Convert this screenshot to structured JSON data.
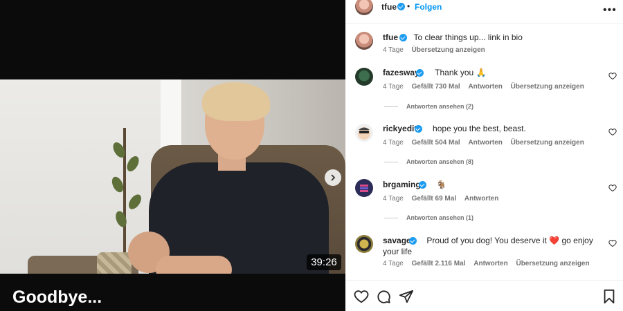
{
  "media": {
    "duration": "39:26",
    "caption_title": "Goodbye..."
  },
  "post": {
    "author": "tfue",
    "dot": "•",
    "follow_label": "Folgen",
    "more_label": "•••",
    "caption": {
      "username": "tfue",
      "text": "To clear things up... link in bio",
      "age": "4 Tage",
      "translate": "Übersetzung anzeigen"
    }
  },
  "comments": [
    {
      "username": "fazesway",
      "text": "Thank you 🙏",
      "age": "4 Tage",
      "likes": "Gefällt 730 Mal",
      "reply": "Antworten",
      "translate": "Übersetzung anzeigen",
      "view_replies": "Antworten ansehen (2)"
    },
    {
      "username": "rickyedit",
      "text": "hope you the best, beast.",
      "age": "4 Tage",
      "likes": "Gefällt 504 Mal",
      "reply": "Antworten",
      "translate": "Übersetzung anzeigen",
      "view_replies": "Antworten ansehen (8)"
    },
    {
      "username": "brgaming",
      "text": "🐐",
      "age": "4 Tage",
      "likes": "Gefällt 69 Mal",
      "reply": "Antworten",
      "view_replies": "Antworten ansehen (1)"
    },
    {
      "username": "savage",
      "text": "Proud of you dog! You deserve it ❤️ go enjoy your life",
      "age": "4 Tage",
      "likes": "Gefällt 2.116 Mal",
      "reply": "Antworten",
      "translate": "Übersetzung anzeigen"
    }
  ],
  "colors": {
    "accent": "#0095f6",
    "verified": "#1d9bf0",
    "muted": "#737373"
  },
  "icons": [
    "heart-icon",
    "comment-icon",
    "share-icon",
    "bookmark-icon",
    "chevron-right-icon",
    "more-icon",
    "verified-icon"
  ]
}
